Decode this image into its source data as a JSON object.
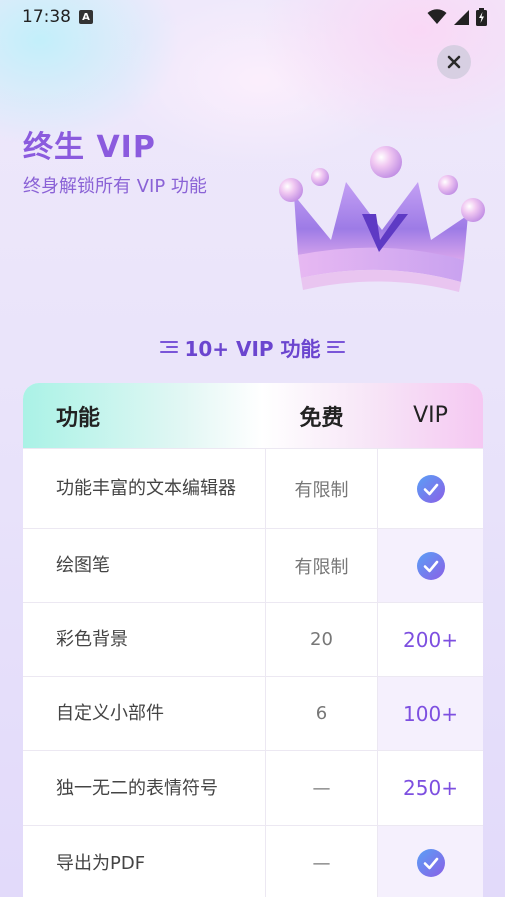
{
  "status_bar": {
    "time": "17:38",
    "notification_icon": "a-icon",
    "icons": [
      "wifi-icon",
      "signal-icon",
      "battery-icon"
    ]
  },
  "close_button": {
    "icon": "close-icon"
  },
  "header": {
    "title": "终生 VIP",
    "subtitle": "终身解锁所有 VIP 功能",
    "crown_letter": "v"
  },
  "section": {
    "heading": "10+ VIP 功能"
  },
  "table": {
    "columns": {
      "feature": "功能",
      "free": "免费",
      "vip": "VIP"
    },
    "rows": [
      {
        "feature": "功能丰富的文本编辑器",
        "free": "有限制",
        "vip": "check"
      },
      {
        "feature": "绘图笔",
        "free": "有限制",
        "vip": "check"
      },
      {
        "feature": "彩色背景",
        "free": "20",
        "vip": "200+"
      },
      {
        "feature": "自定义小部件",
        "free": "6",
        "vip": "100+"
      },
      {
        "feature": "独一无二的表情符号",
        "free": "—",
        "vip": "250+"
      },
      {
        "feature": "导出为PDF",
        "free": "—",
        "vip": "check"
      }
    ]
  },
  "colors": {
    "accent": "#8b5bde",
    "check": "#6b8cf0",
    "header_left": "#aaf2e6",
    "header_right": "#f5c8f2"
  }
}
